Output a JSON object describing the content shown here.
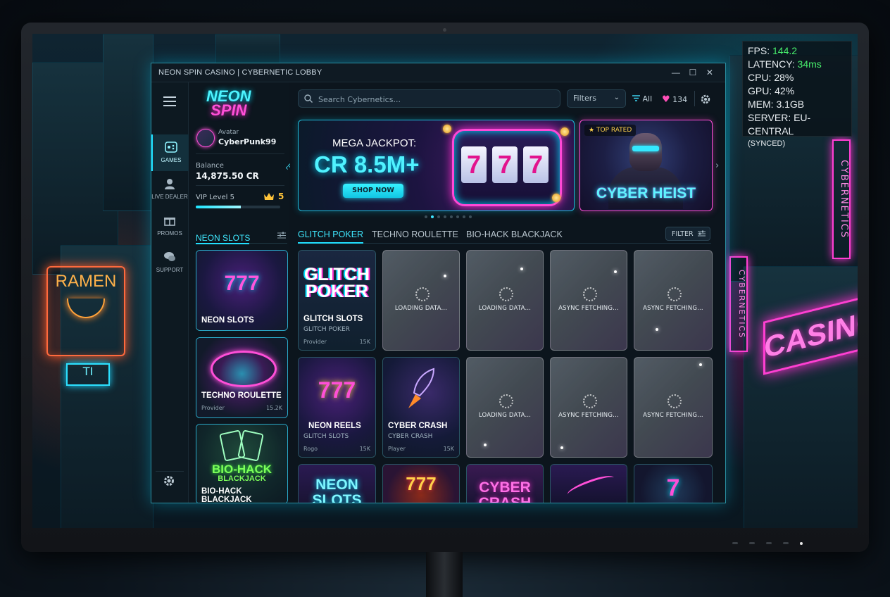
{
  "window": {
    "title": "NEON SPIN CASINO | CYBERNETIC LOBBY",
    "controls": {
      "minimize": "—",
      "maximize": "☐",
      "close": "✕"
    }
  },
  "hud": {
    "fps_label": "FPS:",
    "fps_value": "144.2",
    "latency_label": "LATENCY:",
    "latency_value": "34ms",
    "cpu": "CPU: 28%",
    "gpu": "GPU: 42%",
    "mem": "MEM: 3.1GB",
    "server": "SERVER: EU-CENTRAL",
    "synced": "(SYNCED)"
  },
  "environment": {
    "ramen_sign": "RAMEN",
    "casino_sign": "CASINO",
    "vertical_sign_1": "CYBERNETICS",
    "vertical_sign_2": "CYBERNETICS",
    "small_sign": "TI"
  },
  "rail": {
    "items": [
      {
        "label": "GAMES",
        "icon": "games-icon",
        "active": true
      },
      {
        "label": "LIVE DEALER",
        "icon": "dealer-icon",
        "active": false
      },
      {
        "label": "PROMOS",
        "icon": "gift-icon",
        "active": false
      },
      {
        "label": "SUPPORT",
        "icon": "chat-icon",
        "active": false
      }
    ]
  },
  "logo": {
    "line1": "NEON",
    "line2": "SPIN"
  },
  "profile": {
    "avatar_label": "Avatar",
    "username": "CyberPunk99",
    "balance_label": "Balance",
    "balance_value": "14,875.50 CR",
    "vip_label": "VIP Level",
    "vip_level": "5",
    "vip_progress": 0.53
  },
  "side_section": {
    "title": "NEON SLOTS"
  },
  "side_cards": [
    {
      "name": "NEON SLOTS",
      "art": "777"
    },
    {
      "name": "TECHNO ROULETTE",
      "provider": "Provider",
      "players": "15.2K"
    },
    {
      "name": "BIO-HACK BLACKJACK",
      "art_line1": "BIO-HACK",
      "art_line2": "BLACKJACK"
    }
  ],
  "toolbar": {
    "search_placeholder": "Search Cybernetics...",
    "filters_label": "Filters",
    "filter_all": "All",
    "favorites_count": "134"
  },
  "banner": {
    "title": "MEGA JACKPOT:",
    "amount": "CR 8.5M+",
    "button": "SHOP NOW",
    "reels": [
      "7",
      "7",
      "7"
    ]
  },
  "featured": {
    "badge": "TOP RATED",
    "title": "CYBER HEIST"
  },
  "carousel": {
    "dots": 8,
    "active_index": 2
  },
  "main_tabs": [
    {
      "label": "GLITCH POKER",
      "active": true
    },
    {
      "label": "TECHNO ROULETTE",
      "active": false
    },
    {
      "label": "BIO-HACK BLACKJACK",
      "active": false
    }
  ],
  "filter_button": "FILTER",
  "game_cards": [
    {
      "name": "GLITCH SLOTS",
      "sub": "GLITCH POKER",
      "provider": "Provider",
      "players": "15K",
      "art_line1": "GLITCH",
      "art_line2": "POKER"
    },
    {
      "name": "NEON REELS",
      "sub": "GLITCH SLOTS",
      "provider": "Rogo",
      "players": "15K",
      "art": "777"
    },
    {
      "name": "CYBER CRASH",
      "sub": "CYBER CRASH",
      "provider": "Player",
      "players": "15K"
    }
  ],
  "loading_tiles": [
    "LOADING DATA...",
    "LOADING DATA...",
    "ASYNC FETCHING...",
    "ASYNC FETCHING...",
    "LOADING DATA...",
    "ASYNC FETCHING...",
    "ASYNC FETCHING..."
  ],
  "bottom_cards": [
    {
      "art": "NEON SLOTS"
    },
    {
      "art": "777"
    },
    {
      "art": "CYBER CRASH"
    },
    {
      "art": ""
    },
    {
      "art": "7"
    }
  ],
  "colors": {
    "accent_cyan": "#22e0ff",
    "accent_magenta": "#ff4fd8",
    "vip_gold": "#ffc43a",
    "hud_green": "#48ef6c"
  }
}
